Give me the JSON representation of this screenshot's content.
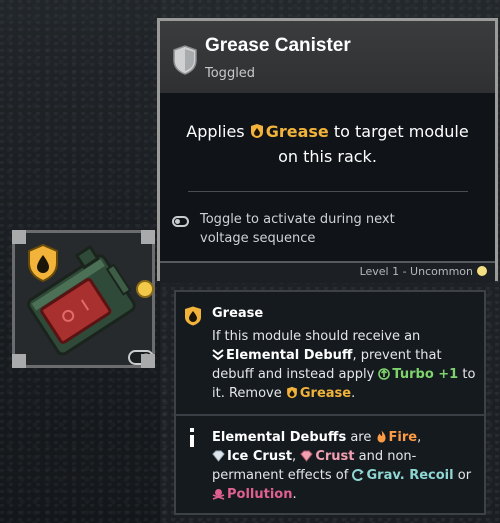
{
  "card": {
    "title": "Grease Canister",
    "subtitle": "Toggled",
    "applies_pre": "Applies",
    "applies_keyword": "Grease",
    "applies_post": "to target module",
    "applies_line2": "on this rack.",
    "toggle_text": "Toggle to activate during next voltage sequence",
    "rarity": "Level 1 - Uncommon",
    "rarity_color": "#f4e082"
  },
  "info": {
    "grease": {
      "title": "Grease",
      "line1": "If this module should receive an",
      "debuff": "Elemental Debuff",
      "line2a": ", prevent that",
      "line3a": "debuff and instead apply",
      "turbo": "Turbo +1",
      "line3b": "to",
      "line4a": "it. Remove",
      "grease": "Grease",
      "line4b": "."
    },
    "debuffs": {
      "label": "Elemental Debuffs",
      "are": "are",
      "fire": "Fire",
      "comma": ",",
      "ice": "Ice Crust",
      "comma2": ",",
      "crust": "Crust",
      "and_non": "and non-",
      "permanent": "permanent effects of",
      "grav": "Grav. Recoil",
      "or": "or",
      "pollution": "Pollution",
      "period": "."
    }
  },
  "colors": {
    "grease": "#f2b33a",
    "turbo": "#7fd36d",
    "fire": "#ff9b45",
    "crust": "#f2a0b0",
    "grav": "#8fd6d2",
    "pollution": "#e0608f"
  },
  "icons": {
    "module": "grease-canister-icon",
    "shield": "shield-icon",
    "toggle": "toggle-icon",
    "info": "info-icon"
  }
}
